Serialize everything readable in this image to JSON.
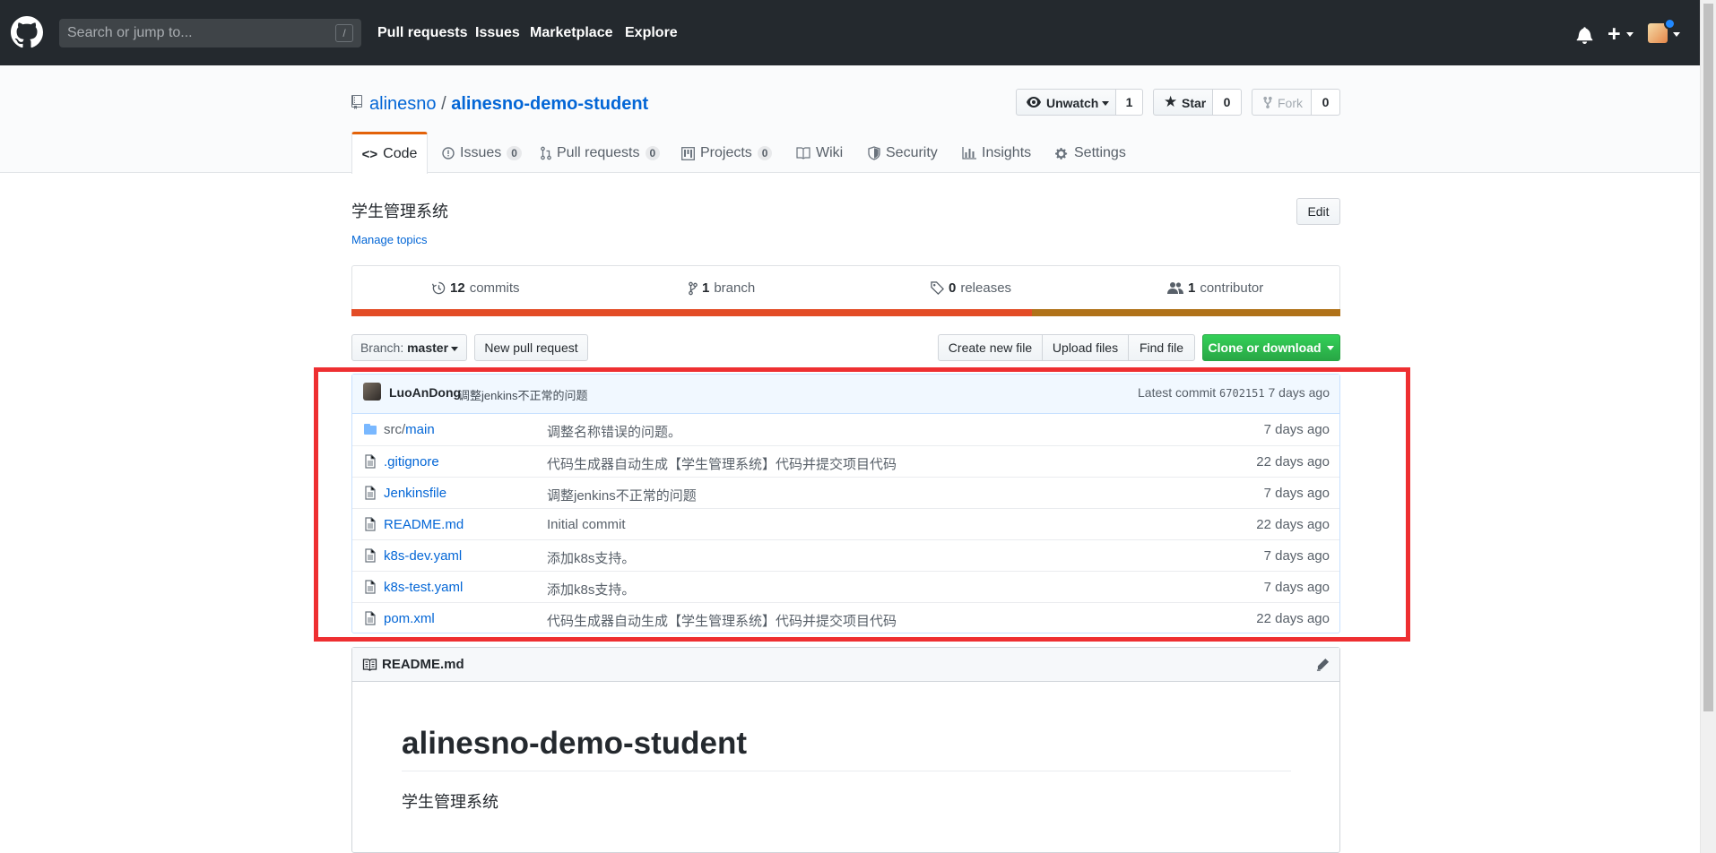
{
  "header": {
    "search_placeholder": "Search or jump to...",
    "search_shortcut": "/",
    "nav": [
      "Pull requests",
      "Issues",
      "Marketplace",
      "Explore"
    ]
  },
  "repo": {
    "owner": "alinesno",
    "separator": "/",
    "name": "alinesno-demo-student",
    "watch_label": "Unwatch",
    "watch_count": "1",
    "star_label": "Star",
    "star_count": "0",
    "fork_label": "Fork",
    "fork_count": "0"
  },
  "tabs": [
    {
      "label": "Code",
      "count": ""
    },
    {
      "label": "Issues",
      "count": "0"
    },
    {
      "label": "Pull requests",
      "count": "0"
    },
    {
      "label": "Projects",
      "count": "0"
    },
    {
      "label": "Wiki",
      "count": ""
    },
    {
      "label": "Security",
      "count": ""
    },
    {
      "label": "Insights",
      "count": ""
    },
    {
      "label": "Settings",
      "count": ""
    }
  ],
  "about": {
    "description": "学生管理系统",
    "manage_topics": "Manage topics",
    "edit_label": "Edit"
  },
  "summary": {
    "commits_num": "12",
    "commits_label": "commits",
    "branch_num": "1",
    "branch_label": "branch",
    "releases_num": "0",
    "releases_label": "releases",
    "contributor_num": "1",
    "contributor_label": "contributor"
  },
  "languages": [
    {
      "color": "#e34c26",
      "percent": 68.8
    },
    {
      "color": "#b07219",
      "percent": 31.2
    }
  ],
  "actions": {
    "branch_prefix": "Branch:",
    "branch_name": "master",
    "new_pull_request": "New pull request",
    "create_new_file": "Create new file",
    "upload_files": "Upload files",
    "find_file": "Find file",
    "clone_or_download": "Clone or download"
  },
  "latest_commit": {
    "author": "LuoAnDong",
    "message": "调整jenkins不正常的问题",
    "label": "Latest commit",
    "sha": "6702151",
    "age": "7 days ago"
  },
  "files": [
    {
      "type": "directory",
      "name_dim": "src/",
      "name": "main",
      "message": "调整名称错误的问题。",
      "age": "7 days ago"
    },
    {
      "type": "file",
      "name_dim": "",
      "name": ".gitignore",
      "message": "代码生成器自动生成【学生管理系统】代码并提交项目代码",
      "age": "22 days ago"
    },
    {
      "type": "file",
      "name_dim": "",
      "name": "Jenkinsfile",
      "message": "调整jenkins不正常的问题",
      "age": "7 days ago"
    },
    {
      "type": "file",
      "name_dim": "",
      "name": "README.md",
      "message": "Initial commit",
      "age": "22 days ago"
    },
    {
      "type": "file",
      "name_dim": "",
      "name": "k8s-dev.yaml",
      "message": "添加k8s支持。",
      "age": "7 days ago"
    },
    {
      "type": "file",
      "name_dim": "",
      "name": "k8s-test.yaml",
      "message": "添加k8s支持。",
      "age": "7 days ago"
    },
    {
      "type": "file",
      "name_dim": "",
      "name": "pom.xml",
      "message": "代码生成器自动生成【学生管理系统】代码并提交项目代码",
      "age": "22 days ago"
    }
  ],
  "readme": {
    "filename": "README.md",
    "heading": "alinesno-demo-student",
    "body": "学生管理系统"
  },
  "colors": {
    "highlight_border": "#ee2f31",
    "link": "#0366d6",
    "header_bg": "#24292e",
    "clone_green": "#28a745"
  }
}
